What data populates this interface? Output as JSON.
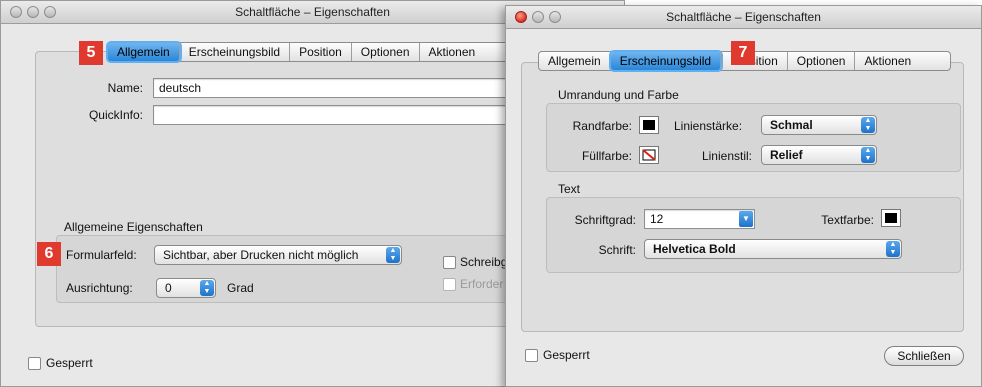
{
  "left_window": {
    "title": "Schaltfläche – Eigenschaften",
    "tabs": [
      "Allgemein",
      "Erscheinungsbild",
      "Position",
      "Optionen",
      "Aktionen"
    ],
    "selected_tab": "Allgemein",
    "badge_top": "5",
    "badge_mid": "6",
    "name_label": "Name:",
    "name_value": "deutsch",
    "quickinfo_label": "QuickInfo:",
    "quickinfo_value": "",
    "section_title": "Allgemeine Eigenschaften",
    "formularfeld_label": "Formularfeld:",
    "formularfeld_value": "Sichtbar, aber Drucken nicht möglich",
    "schreibgeschuetzt_label": "Schreibg",
    "erforderlich_label": "Erforder",
    "ausrichtung_label": "Ausrichtung:",
    "ausrichtung_value": "0",
    "grad_label": "Grad",
    "gesperrt_label": "Gesperrt"
  },
  "right_window": {
    "title": "Schaltfläche – Eigenschaften",
    "tabs": [
      "Allgemein",
      "Erscheinungsbild",
      "Position",
      "Optionen",
      "Aktionen"
    ],
    "tab_position_visible": "osition",
    "selected_tab": "Erscheinungsbild",
    "badge": "7",
    "group1_title": "Umrandung und Farbe",
    "randfarbe_label": "Randfarbe:",
    "linienstaerke_label": "Linienstärke:",
    "linienstaerke_value": "Schmal",
    "fuellfarbe_label": "Füllfarbe:",
    "linienstil_label": "Linienstil:",
    "linienstil_value": "Relief",
    "group2_title": "Text",
    "schriftgrad_label": "Schriftgrad:",
    "schriftgrad_value": "12",
    "textfarbe_label": "Textfarbe:",
    "schrift_label": "Schrift:",
    "schrift_value": "Helvetica Bold",
    "gesperrt_label": "Gesperrt",
    "close_button": "Schließen"
  },
  "colors": {
    "accent_blue": "#2a86d8",
    "badge_red": "#e03a2f",
    "border_color_swatch": "#000000",
    "text_color_swatch": "#000000"
  }
}
